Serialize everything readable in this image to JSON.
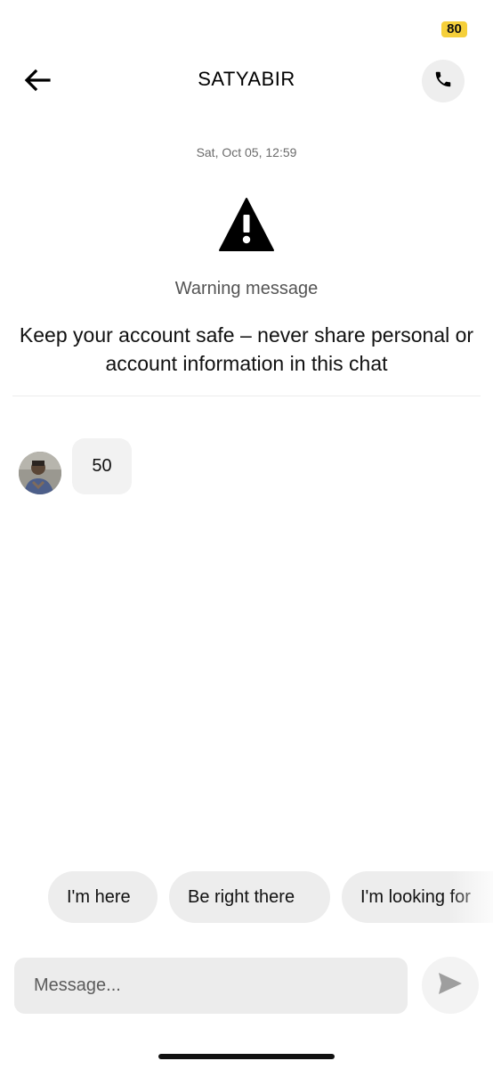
{
  "status_bar": {
    "badge_value": "80",
    "badge_color": "#f5cf3a"
  },
  "header": {
    "title": "SATYABIR",
    "back_icon": "arrow-left-icon",
    "call_icon": "phone-icon"
  },
  "conversation": {
    "timestamp": "Sat, Oct 05, 12:59",
    "warning": {
      "icon": "warning-triangle-icon",
      "title": "Warning message",
      "body": "Keep your account safe – never share personal or account information in this chat"
    },
    "messages": [
      {
        "sender": "SATYABIR",
        "text": "50"
      }
    ]
  },
  "quick_replies": [
    "I'm here",
    "Be right there",
    "I'm looking for"
  ],
  "composer": {
    "placeholder": "Message...",
    "send_icon": "send-icon"
  }
}
